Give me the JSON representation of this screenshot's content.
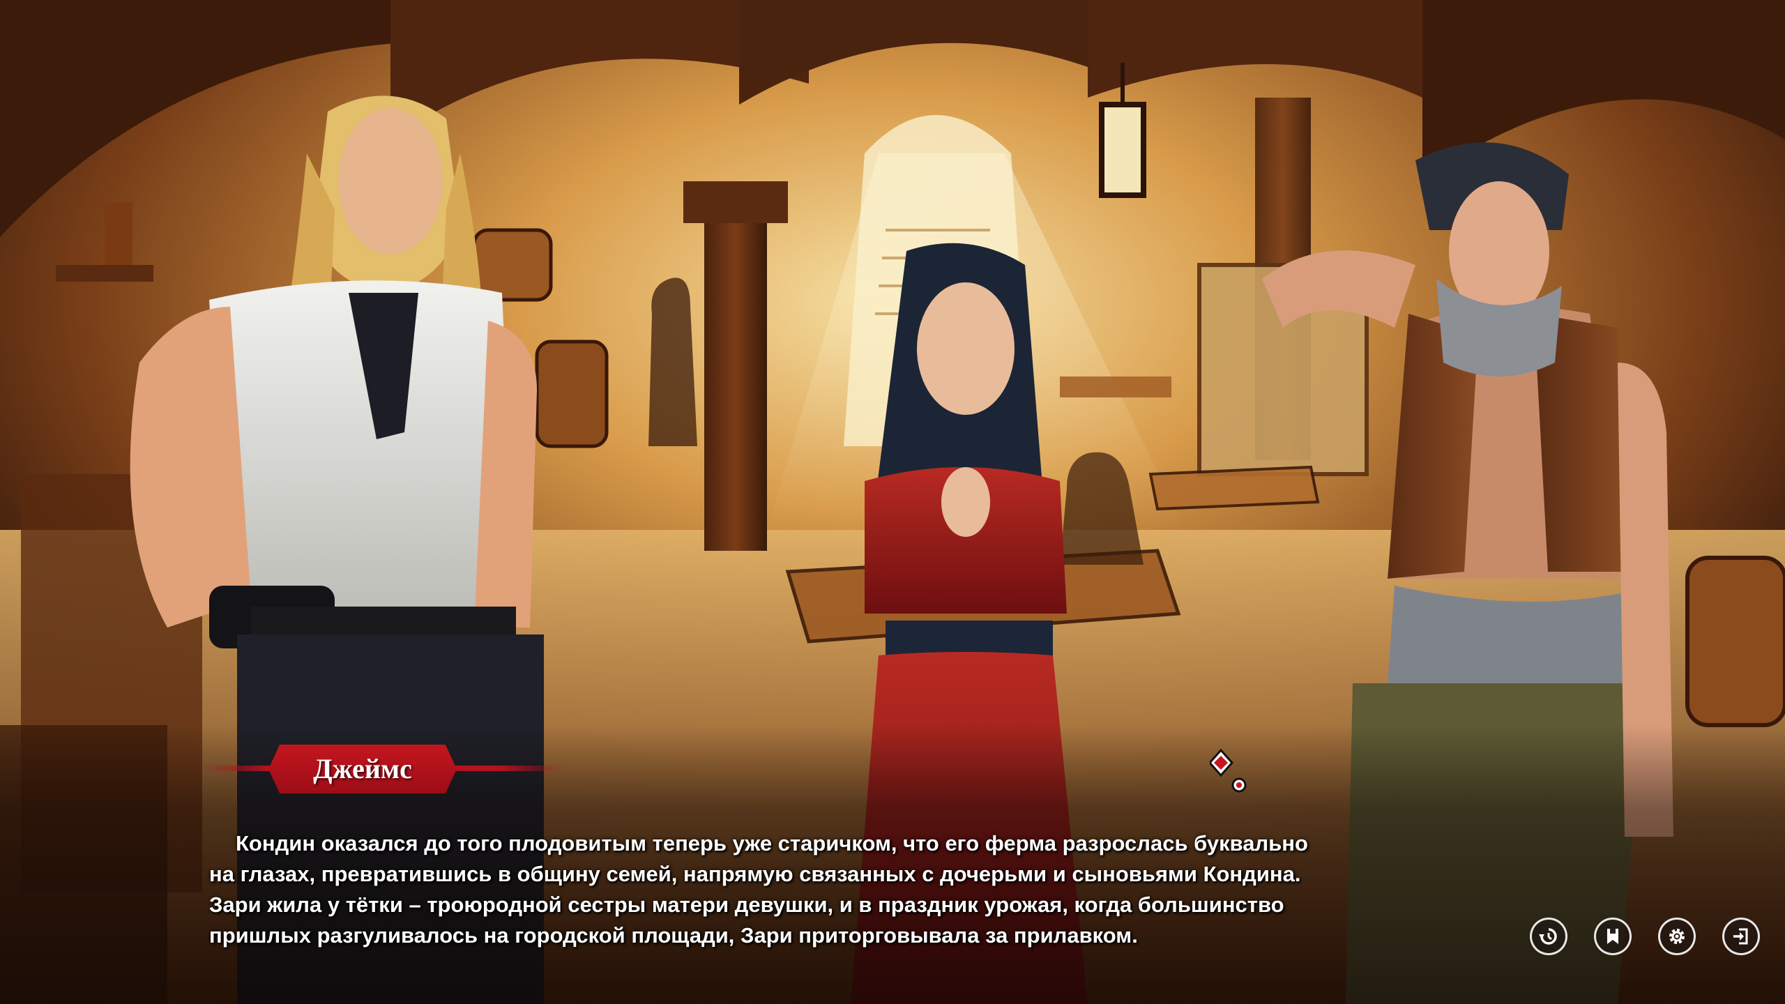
{
  "speaker": {
    "name": "Джеймс"
  },
  "dialogue": {
    "lines": [
      "Кондин оказался до того плодовитым теперь уже старичком, что его ферма разрослась буквально",
      "на глазах, превратившись в общину семей, напрямую связанных с дочерьми и сыновьями Кондина.",
      "Зари жила у тётки – троюродной сестры матери девушки, и в праздник урожая, когда большинство",
      "пришлых разгуливалось на городской площади, Зари приторговывала за прилавком."
    ]
  },
  "menu": {
    "buttons": [
      {
        "name": "rollback-button",
        "icon": "rollback-icon"
      },
      {
        "name": "save-button",
        "icon": "bookmark-icon"
      },
      {
        "name": "settings-button",
        "icon": "gear-icon"
      },
      {
        "name": "exit-button",
        "icon": "exit-icon"
      }
    ]
  },
  "colors": {
    "banner_red": "#b3121e",
    "text": "#ffffff",
    "scene_warm": "#b7702c",
    "scene_dark": "#3a1c0c"
  }
}
